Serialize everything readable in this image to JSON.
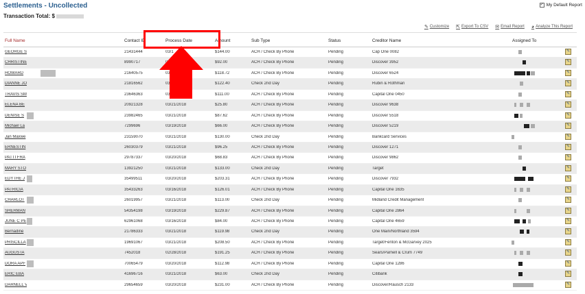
{
  "page": {
    "title": "Settlements - Uncollected",
    "transaction_total_label": "Transaction Total: $",
    "default_report_label": "My Default Report",
    "default_report_checked": true
  },
  "toolbar": {
    "customize": "Customize",
    "export": "Export To CSV",
    "email": "Email Report",
    "analyze": "Analyze This Report"
  },
  "columns": {
    "full_name": "Full Name",
    "contact_id": "Contact ID",
    "process_date": "Process Date",
    "amount": "Amount",
    "sub_type": "Sub Type",
    "status": "Status",
    "creditor_name": "Creditor Name",
    "assigned_to": "Assigned To"
  },
  "rows": [
    {
      "name": "GEORGE S",
      "contact_id": "21431444",
      "date": "03/1",
      "amount": "$144.00",
      "sub_type": "ACH / Check By Phone",
      "status": "Pending",
      "creditor": "Cap One 0082"
    },
    {
      "name": "CHRISTINE",
      "contact_id": "8990717",
      "date": "03/1",
      "amount": "$92.00",
      "sub_type": "ACH / Check By Phone",
      "status": "Pending",
      "creditor": "Discover 3952"
    },
    {
      "name": "HOWARD",
      "contact_id": "21640575",
      "date": "03/1",
      "amount": "$118.72",
      "sub_type": "ACH / Check By Phone",
      "status": "Pending",
      "creditor": "Discover 6524"
    },
    {
      "name": "DIANNE JO",
      "contact_id": "21816562",
      "date": "03/1",
      "amount": "$122.40",
      "sub_type": "Check 2nd Day",
      "status": "Pending",
      "creditor": "Rubin & Rothman"
    },
    {
      "name": "TRAVIS SM",
      "contact_id": "23646363",
      "date": "03/1",
      "amount": "$111.00",
      "sub_type": "ACH / Check By Phone",
      "status": "Pending",
      "creditor": "Capital One 0450"
    },
    {
      "name": "ELENA BE",
      "contact_id": "20921328",
      "date": "03/21/2018",
      "amount": "$25.80",
      "sub_type": "ACH / Check By Phone",
      "status": "Pending",
      "creditor": "Discover 9638"
    },
    {
      "name": "DENISE S",
      "contact_id": "23982465",
      "date": "03/21/2018",
      "amount": "$87.62",
      "sub_type": "ACH / Check By Phone",
      "status": "Pending",
      "creditor": "Discover 5518"
    },
    {
      "name": "Michael La",
      "contact_id": "7299696",
      "date": "03/19/2018",
      "amount": "$66.00",
      "sub_type": "ACH / Check By Phone",
      "status": "Pending",
      "creditor": "Discover 5219"
    },
    {
      "name": "Jan Maxwe",
      "contact_id": "23159070",
      "date": "03/21/2018",
      "amount": "$130.00",
      "sub_type": "Check 2nd Day",
      "status": "Pending",
      "creditor": "Bankcard Services"
    },
    {
      "name": "ERNESTIN",
      "contact_id": "26030379",
      "date": "03/21/2018",
      "amount": "$96.25",
      "sub_type": "ACH / Check By Phone",
      "status": "Pending",
      "creditor": "Discover 1271"
    },
    {
      "name": "PATTI FRA",
      "contact_id": "29787337",
      "date": "03/20/2018",
      "amount": "$68.83",
      "sub_type": "ACH / Check By Phone",
      "status": "Pending",
      "creditor": "Discover 9862"
    },
    {
      "name": "MARY STO",
      "contact_id": "13921250",
      "date": "03/21/2018",
      "amount": "$133.00",
      "sub_type": "Check 2nd Day",
      "status": "Pending",
      "creditor": "Target"
    },
    {
      "name": "EDYTHE J",
      "contact_id": "35499511",
      "date": "03/20/2018",
      "amount": "$203.31",
      "sub_type": "ACH / Check By Phone",
      "status": "Pending",
      "creditor": "Discover 7932"
    },
    {
      "name": "PATRICIA",
      "contact_id": "35433263",
      "date": "03/16/2018",
      "amount": "$126.01",
      "sub_type": "ACH / Check By Phone",
      "status": "Pending",
      "creditor": "Capital One 1635"
    },
    {
      "name": "CHARLOT",
      "contact_id": "26019957",
      "date": "03/21/2018",
      "amount": "$113.00",
      "sub_type": "Check 2nd Day",
      "status": "Pending",
      "creditor": "Midland Credit Management"
    },
    {
      "name": "SHERMAN",
      "contact_id": "54354198",
      "date": "03/19/2018",
      "amount": "$229.87",
      "sub_type": "ACH / Check By Phone",
      "status": "Pending",
      "creditor": "Capital One 2864"
    },
    {
      "name": "JUNE C PE",
      "contact_id": "62961068",
      "date": "03/16/2018",
      "amount": "$84.00",
      "sub_type": "ACH / Check By Phone",
      "status": "Pending",
      "creditor": "Capital One 4659"
    },
    {
      "name": "Bernadine",
      "contact_id": "21786333",
      "date": "03/21/2018",
      "amount": "$119.98",
      "sub_type": "Check 2nd Day",
      "status": "Pending",
      "creditor": "One Main/Northland 3594"
    },
    {
      "name": "PRISCILLA",
      "contact_id": "19691067",
      "date": "03/21/2018",
      "amount": "$208.50",
      "sub_type": "ACH / Check By Phone",
      "status": "Pending",
      "creditor": "Target/Fenton & McGarvey 2025"
    },
    {
      "name": "AUGUSTA",
      "contact_id": "7452018",
      "date": "02/28/2018",
      "amount": "$191.25",
      "sub_type": "ACH / Check By Phone",
      "status": "Pending",
      "creditor": "Sears/Parnell & Crum 7749"
    },
    {
      "name": "DORA APF",
      "contact_id": "70065479",
      "date": "03/20/2018",
      "amount": "$112.98",
      "sub_type": "ACH / Check By Phone",
      "status": "Pending",
      "creditor": "Capital One 1286"
    },
    {
      "name": "ERIC EBA",
      "contact_id": "41696716",
      "date": "03/21/2018",
      "amount": "$63.00",
      "sub_type": "Check 2nd Day",
      "status": "Pending",
      "creditor": "Citibank"
    },
    {
      "name": "DARNELL V",
      "contact_id": "29654659",
      "date": "03/20/2018",
      "amount": "$231.00",
      "sub_type": "ACH / Check By Phone",
      "status": "Pending",
      "creditor": "Discover/Rausch 2133"
    }
  ],
  "icons": {
    "checkbox": "checkbox-icon",
    "customize": "wrench-icon",
    "export": "export-icon",
    "email": "envelope-icon",
    "analyze": "chart-icon",
    "edit": "edit-icon"
  },
  "colors": {
    "title": "#2b5f8f",
    "sorted_header": "#a52a2a",
    "annotation": "#ff0000",
    "row_alt": "#ebebeb"
  }
}
